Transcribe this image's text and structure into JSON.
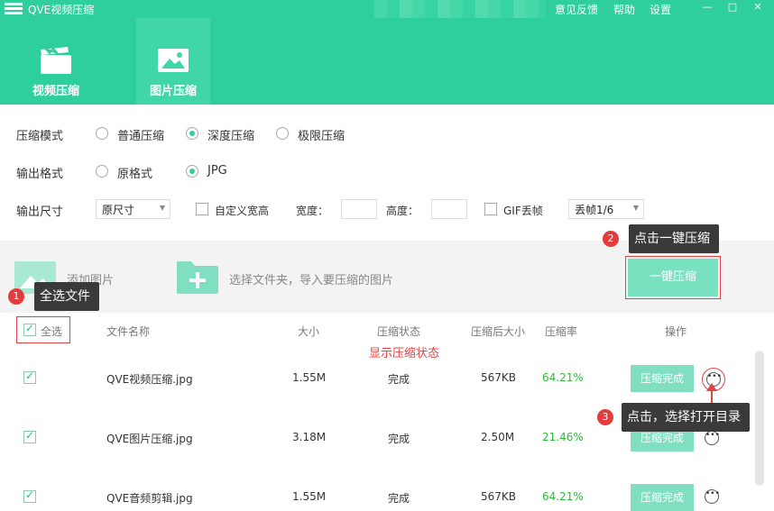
{
  "app": {
    "title": "QVE视频压缩"
  },
  "title_menu": {
    "feedback": "意见反馈",
    "help": "帮助",
    "settings": "设置"
  },
  "window_controls": {
    "minimize": "—",
    "maximize": "□",
    "close": "✕"
  },
  "tabs": [
    {
      "label": "视频压缩",
      "icon": "film-icon",
      "active": false
    },
    {
      "label": "图片压缩",
      "icon": "image-icon",
      "active": true
    }
  ],
  "options": {
    "mode_label": "压缩模式",
    "modes": [
      {
        "label": "普通压缩",
        "selected": false
      },
      {
        "label": "深度压缩",
        "selected": true
      },
      {
        "label": "极限压缩",
        "selected": false
      }
    ],
    "format_label": "输出格式",
    "formats": [
      {
        "label": "原格式",
        "selected": false
      },
      {
        "label": "JPG",
        "selected": true
      }
    ],
    "size_label": "输出尺寸",
    "size_value": "原尺寸",
    "custom_size_label": "自定义宽高",
    "width_label": "宽度：",
    "height_label": "高度：",
    "gif_drop_label": "GIF丢帧",
    "gif_drop_value": "丢帧1/6"
  },
  "actions": {
    "add_images": "添加图片",
    "choose_folder": "选择文件夹，导入要压缩的图片",
    "compress_all": "一键压缩"
  },
  "table": {
    "headers": {
      "select_all": "全选",
      "name": "文件名称",
      "size": "大小",
      "status": "压缩状态",
      "after_size": "压缩后大小",
      "rate": "压缩率",
      "actions": "操作"
    },
    "status_note": "显示压缩状态",
    "rows": [
      {
        "name": "QVE视频压缩.jpg",
        "size": "1.55M",
        "status": "完成",
        "after": "567KB",
        "rate": "64.21%",
        "button": "压缩完成"
      },
      {
        "name": "QVE图片压缩.jpg",
        "size": "3.18M",
        "status": "完成",
        "after": "2.50M",
        "rate": "21.46%",
        "button": "压缩完成"
      },
      {
        "name": "QVE音频剪辑.jpg",
        "size": "1.55M",
        "status": "完成",
        "after": "567KB",
        "rate": "64.21%",
        "button": "压缩完成"
      }
    ]
  },
  "annotations": [
    {
      "number": "1",
      "text": "全选文件"
    },
    {
      "number": "2",
      "text": "点击一键压缩"
    },
    {
      "number": "3",
      "text": "点击，选择打开目录"
    }
  ],
  "colors": {
    "brand": "#2ecf9c",
    "accent_red": "#e04444",
    "rate_green": "#2dbb3c"
  }
}
